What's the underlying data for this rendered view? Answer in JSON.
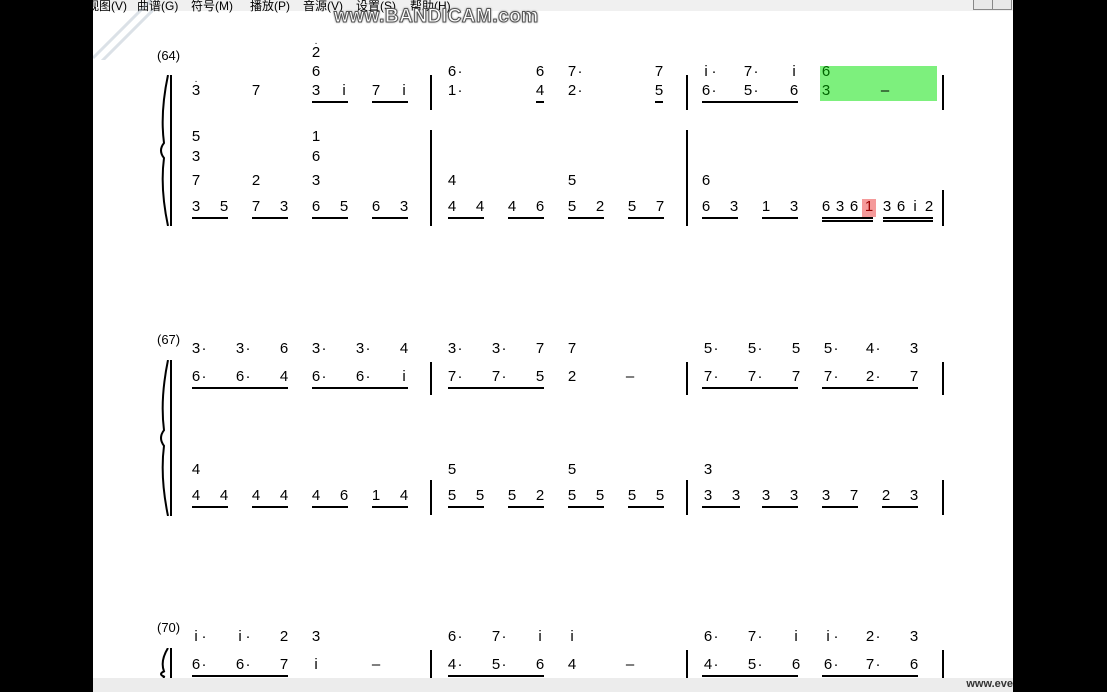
{
  "menubar": {
    "items": [
      "视图(V)",
      "曲谱(G)",
      "符号(M)",
      "播放(P)",
      "音源(V)",
      "设置(S)",
      "帮助(H)"
    ]
  },
  "watermark": "www.BANDICAM.com",
  "measure_numbers": [
    "(64)",
    "(67)",
    "(70)"
  ],
  "footer": "www.eve",
  "systems": [
    {
      "measure": "(64)",
      "treble_top": "2 6 | 6· 6 7· 7 | i· 7· i 6",
      "treble": "3 7 3 i 7 i | 1· 4 2· 5 | 6· 5· 6 3 –",
      "bass_chords": "5 3 7 2 1 6 3 | 4 5 | 6",
      "bass": "3 5 7 3 6 5 6 3 | 4 4 4 6 5 2 5 7 | 6 3 1 3 6 3 6 1 3 6 i 2"
    },
    {
      "measure": "(67)",
      "treble_top": "3· 3· 6 3· 3· 4 | 3· 3· 7 7 | 5· 5· 5 5· 4· 3",
      "treble": "6· 6· 4 6· 6· i | 7· 7· 5 2 – | 7· 7· 7 7· 2· 7",
      "bass": "4 4 4 4 4 6 1 4 | 5 5 5 2 5 5 5 5 | 3 3 3 3 3 7 2 3"
    },
    {
      "measure": "(70)",
      "treble_top": "i· i· 2 3 | 6· 7· i i | 6· 7· i i· 2· 3",
      "treble": "6· 6· 7 i – | 4· 5· 6 4 – | 4· 5· 6 6· 7· 6"
    }
  ]
}
